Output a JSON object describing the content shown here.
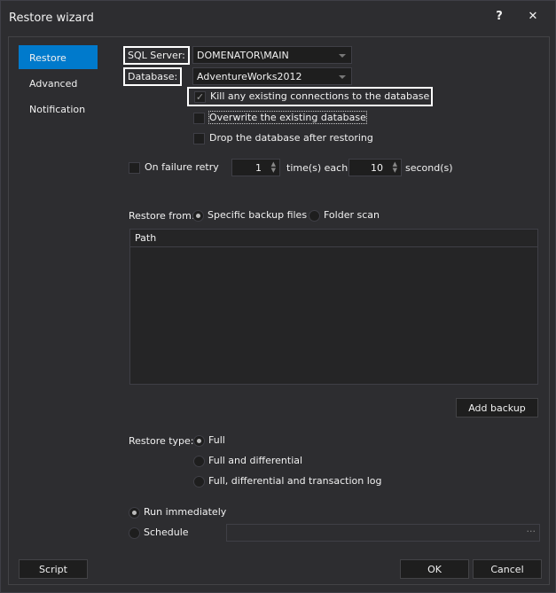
{
  "window": {
    "title": "Restore wizard",
    "help": "?",
    "close": "✕"
  },
  "sidebar": {
    "items": [
      {
        "label": "Restore"
      },
      {
        "label": "Advanced"
      },
      {
        "label": "Notification"
      }
    ]
  },
  "form": {
    "sql_server_label": "SQL Server:",
    "sql_server_value": "DOMENATOR\\MAIN",
    "database_label": "Database:",
    "database_value": "AdventureWorks2012",
    "kill_connections": "Kill any existing connections to the database",
    "overwrite": "Overwrite the existing database",
    "drop_after": "Drop the database after restoring",
    "retry_label": "On failure retry",
    "retry_count": "1",
    "times_each": "time(s) each",
    "retry_seconds": "10",
    "seconds": "second(s)",
    "restore_from_label": "Restore from:",
    "restore_from_options": [
      "Specific backup files",
      "Folder scan"
    ],
    "grid_header": "Path",
    "add_backup": "Add backup",
    "restore_type_label": "Restore type:",
    "restore_types": [
      "Full",
      "Full and differential",
      "Full, differential and transaction log"
    ],
    "run_immediately": "Run immediately",
    "schedule": "Schedule",
    "schedule_button": "···"
  },
  "footer": {
    "script": "Script",
    "ok": "OK",
    "cancel": "Cancel"
  }
}
